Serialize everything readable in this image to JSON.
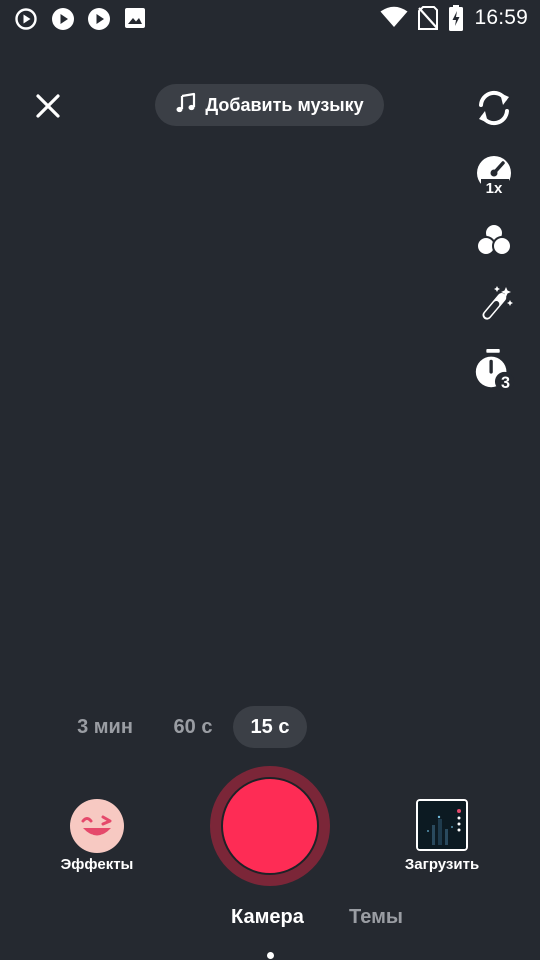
{
  "status_bar": {
    "time": "16:59",
    "left_icons": [
      "play-circle-outline-icon",
      "play-circle-icon",
      "play-circle-icon",
      "image-icon"
    ],
    "right_icons": [
      "wifi-icon",
      "no-sim-icon",
      "battery-charging-icon"
    ]
  },
  "top": {
    "close_icon": "close-icon",
    "music_label": "Добавить музыку",
    "music_icon": "music-note-icon"
  },
  "side_tools": [
    {
      "name": "flip-camera-icon"
    },
    {
      "name": "speed-icon",
      "badge": "1x"
    },
    {
      "name": "filters-icon"
    },
    {
      "name": "beauty-wand-icon"
    },
    {
      "name": "timer-icon",
      "badge": "3"
    }
  ],
  "durations": {
    "items": [
      "3 мин",
      "60 с",
      "15 с"
    ],
    "selected": "15 с"
  },
  "bottom": {
    "effects_label": "Эффекты",
    "upload_label": "Загрузить"
  },
  "modes": {
    "items": [
      "Камера",
      "Темы"
    ],
    "selected": "Камера"
  },
  "colors": {
    "background": "#252930",
    "record": "#fe2c55",
    "record_ring": "#7b2638",
    "pill": "#3b3f46",
    "inactive_text": "#9a9da3"
  }
}
